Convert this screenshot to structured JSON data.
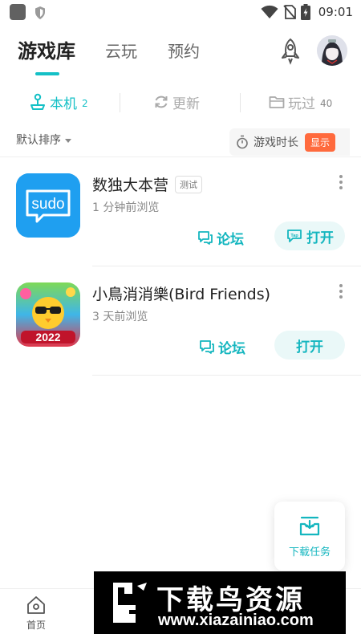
{
  "status_bar": {
    "time": "09:01"
  },
  "header": {
    "tabs": [
      {
        "label": "游戏库",
        "active": true
      },
      {
        "label": "云玩",
        "active": false
      },
      {
        "label": "预约",
        "active": false
      }
    ]
  },
  "subtabs": [
    {
      "label": "本机",
      "count": "2",
      "icon": "joystick-icon",
      "active": true
    },
    {
      "label": "更新",
      "count": "",
      "icon": "refresh-icon",
      "active": false
    },
    {
      "label": "玩过",
      "count": "40",
      "icon": "folder-icon",
      "active": false
    }
  ],
  "sort": {
    "label": "默认排序"
  },
  "playtime": {
    "label": "游戏时长",
    "button": "显示"
  },
  "games": [
    {
      "title": "数独大本营",
      "tag": "测试",
      "subtitle": "1 分钟前浏览",
      "forum_label": "论坛",
      "open_label": "打开",
      "icon_text": "sudo"
    },
    {
      "title": "小鳥消消樂(Bird Friends)",
      "subtitle": "3 天前浏览",
      "forum_label": "论坛",
      "open_label": "打开",
      "icon_text": "2022"
    }
  ],
  "download_tasks": {
    "label": "下载任务"
  },
  "bottom_nav": {
    "home_label": "首页"
  },
  "watermark": {
    "title": "下载鸟资源",
    "url": "www.xiazainiao.com"
  },
  "colors": {
    "accent": "#14c0c6",
    "badge": "#ff6a3d"
  }
}
